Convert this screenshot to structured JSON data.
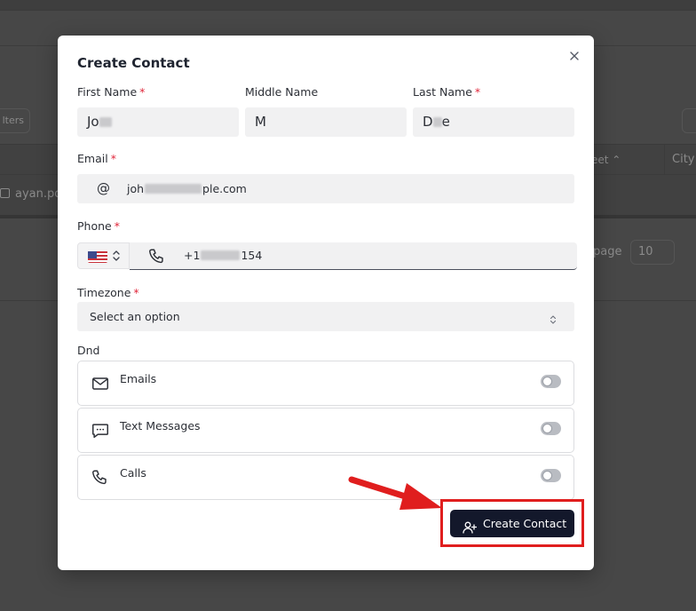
{
  "background": {
    "filters_label": "lters",
    "street_header": "eet",
    "city_header": "City",
    "row_email": "ayan.po",
    "perpage_label": "page",
    "perpage_value": "10"
  },
  "modal": {
    "title": "Create Contact",
    "close_icon": "close-icon",
    "first_name": {
      "label": "First Name",
      "required": "*",
      "value_prefix": "Jo"
    },
    "middle_name": {
      "label": "Middle Name",
      "value": "M"
    },
    "last_name": {
      "label": "Last Name",
      "required": "*",
      "value_prefix": "D",
      "value_suffix": "e"
    },
    "email": {
      "label": "Email",
      "required": "*",
      "icon": "@",
      "value_prefix": "joh",
      "value_suffix": "ple.com"
    },
    "phone": {
      "label": "Phone",
      "required": "*",
      "country_flag": "us-flag-icon",
      "value_prefix": "+1",
      "value_suffix": "154"
    },
    "timezone": {
      "label": "Timezone",
      "required": "*",
      "placeholder": "Select an option"
    },
    "dnd": {
      "label": "Dnd",
      "items": [
        {
          "label": "Emails",
          "icon": "mail-icon",
          "enabled": false
        },
        {
          "label": "Text Messages",
          "icon": "message-icon",
          "enabled": false
        },
        {
          "label": "Calls",
          "icon": "phone-icon",
          "enabled": false
        }
      ]
    },
    "create_button": {
      "label": "Create Contact",
      "icon": "user-plus-icon"
    }
  },
  "annotation": {
    "highlight_color": "#e01e1e"
  }
}
